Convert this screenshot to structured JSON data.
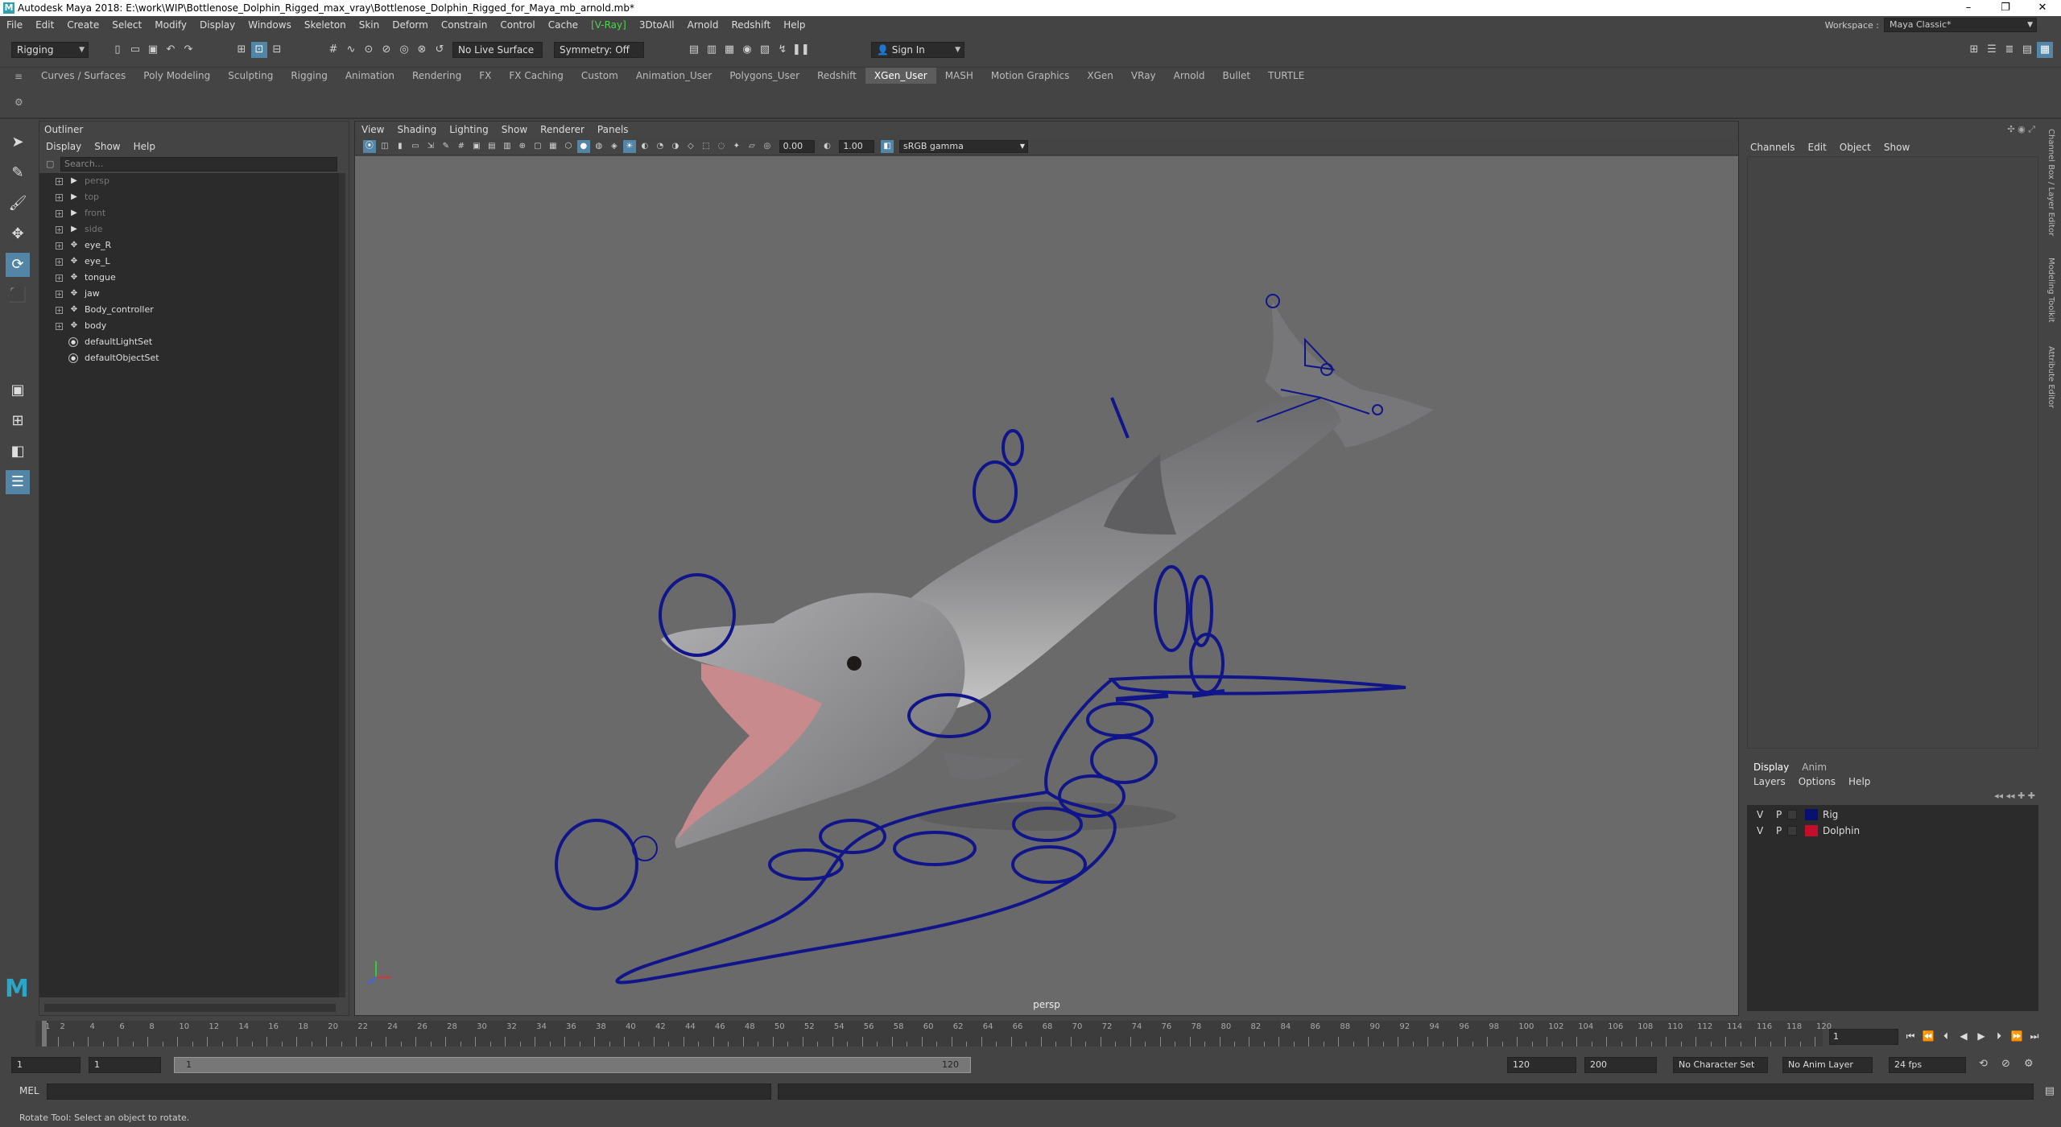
{
  "window": {
    "title": "Autodesk Maya 2018: E:\\work\\WIP\\Bottlenose_Dolphin_Rigged_max_vray\\Bottlenose_Dolphin_Rigged_for_Maya_mb_arnold.mb*",
    "app_icon_letter": "M",
    "minimize": "–",
    "restore": "❐",
    "close": "✕"
  },
  "menubar": {
    "items": [
      "File",
      "Edit",
      "Create",
      "Select",
      "Modify",
      "Display",
      "Windows",
      "Skeleton",
      "Skin",
      "Deform",
      "Constrain",
      "Control",
      "Cache",
      "[V-Ray]",
      "3DtoAll",
      "Arnold",
      "Redshift",
      "Help"
    ],
    "workspace_label": "Workspace :",
    "workspace_value": "Maya Classic*"
  },
  "statusline": {
    "menuset": "Rigging",
    "live_surface": "No Live Surface",
    "symmetry": "Symmetry: Off",
    "sign_in": "Sign In"
  },
  "shelf": {
    "tabs": [
      "Curves / Surfaces",
      "Poly Modeling",
      "Sculpting",
      "Rigging",
      "Animation",
      "Rendering",
      "FX",
      "FX Caching",
      "Custom",
      "Animation_User",
      "Polygons_User",
      "Redshift",
      "XGen_User",
      "MASH",
      "Motion Graphics",
      "XGen",
      "VRay",
      "Arnold",
      "Bullet",
      "TURTLE"
    ],
    "active": "XGen_User"
  },
  "outliner": {
    "title": "Outliner",
    "menu": [
      "Display",
      "Show",
      "Help"
    ],
    "search_placeholder": "Search...",
    "items": [
      {
        "label": "persp",
        "kind": "camera",
        "dim": true
      },
      {
        "label": "top",
        "kind": "camera",
        "dim": true
      },
      {
        "label": "front",
        "kind": "camera",
        "dim": true
      },
      {
        "label": "side",
        "kind": "camera",
        "dim": true
      },
      {
        "label": "eye_R",
        "kind": "transform",
        "dim": false
      },
      {
        "label": "eye_L",
        "kind": "transform",
        "dim": false
      },
      {
        "label": "tongue",
        "kind": "transform",
        "dim": false
      },
      {
        "label": "jaw",
        "kind": "transform",
        "dim": false
      },
      {
        "label": "Body_controller",
        "kind": "transform",
        "dim": false
      },
      {
        "label": "body",
        "kind": "transform",
        "dim": false
      },
      {
        "label": "defaultLightSet",
        "kind": "set",
        "dim": false
      },
      {
        "label": "defaultObjectSet",
        "kind": "set",
        "dim": false
      }
    ]
  },
  "viewport": {
    "menu": [
      "View",
      "Shading",
      "Lighting",
      "Show",
      "Renderer",
      "Panels"
    ],
    "exposure": "0.00",
    "gamma_value": "1.00",
    "color_space": "sRGB gamma",
    "camera": "persp"
  },
  "channelbox": {
    "menu": [
      "Channels",
      "Edit",
      "Object",
      "Show"
    ],
    "side_tabs": [
      "Channel Box / Layer Editor",
      "Modeling Toolkit",
      "Attribute Editor"
    ]
  },
  "layers": {
    "tabs": [
      "Display",
      "Anim"
    ],
    "active_tab": "Display",
    "menu": [
      "Layers",
      "Options",
      "Help"
    ],
    "rows": [
      {
        "v": "V",
        "p": "P",
        "name": "Rig",
        "color": "#0a1070"
      },
      {
        "v": "V",
        "p": "P",
        "name": "Dolphin",
        "color": "#c2102a"
      }
    ]
  },
  "timeline": {
    "ticks": [
      "1",
      "2",
      "4",
      "6",
      "8",
      "10",
      "12",
      "14",
      "16",
      "18",
      "20",
      "22",
      "24",
      "26",
      "28",
      "30",
      "32",
      "34",
      "36",
      "38",
      "40",
      "42",
      "44",
      "46",
      "48",
      "50",
      "52",
      "54",
      "56",
      "58",
      "60",
      "62",
      "64",
      "66",
      "68",
      "70",
      "72",
      "74",
      "76",
      "78",
      "80",
      "82",
      "84",
      "86",
      "88",
      "90",
      "92",
      "94",
      "96",
      "98",
      "100",
      "102",
      "104",
      "106",
      "108",
      "110",
      "112",
      "114",
      "116",
      "118",
      "120"
    ],
    "current_frame": "1"
  },
  "range": {
    "start": "1",
    "playback_start": "1",
    "range_start_label": "1",
    "range_end_label": "120",
    "playback_end": "120",
    "end": "200",
    "character_set": "No Character Set",
    "anim_layer": "No Anim Layer",
    "fps": "24 fps"
  },
  "cmdline": {
    "label": "MEL"
  },
  "helpline": {
    "text": "Rotate Tool: Select an object to rotate."
  },
  "colors": {
    "rig_curve": "#10158a",
    "accent": "#5285a6",
    "maya_logo": "#2aa7c8"
  }
}
